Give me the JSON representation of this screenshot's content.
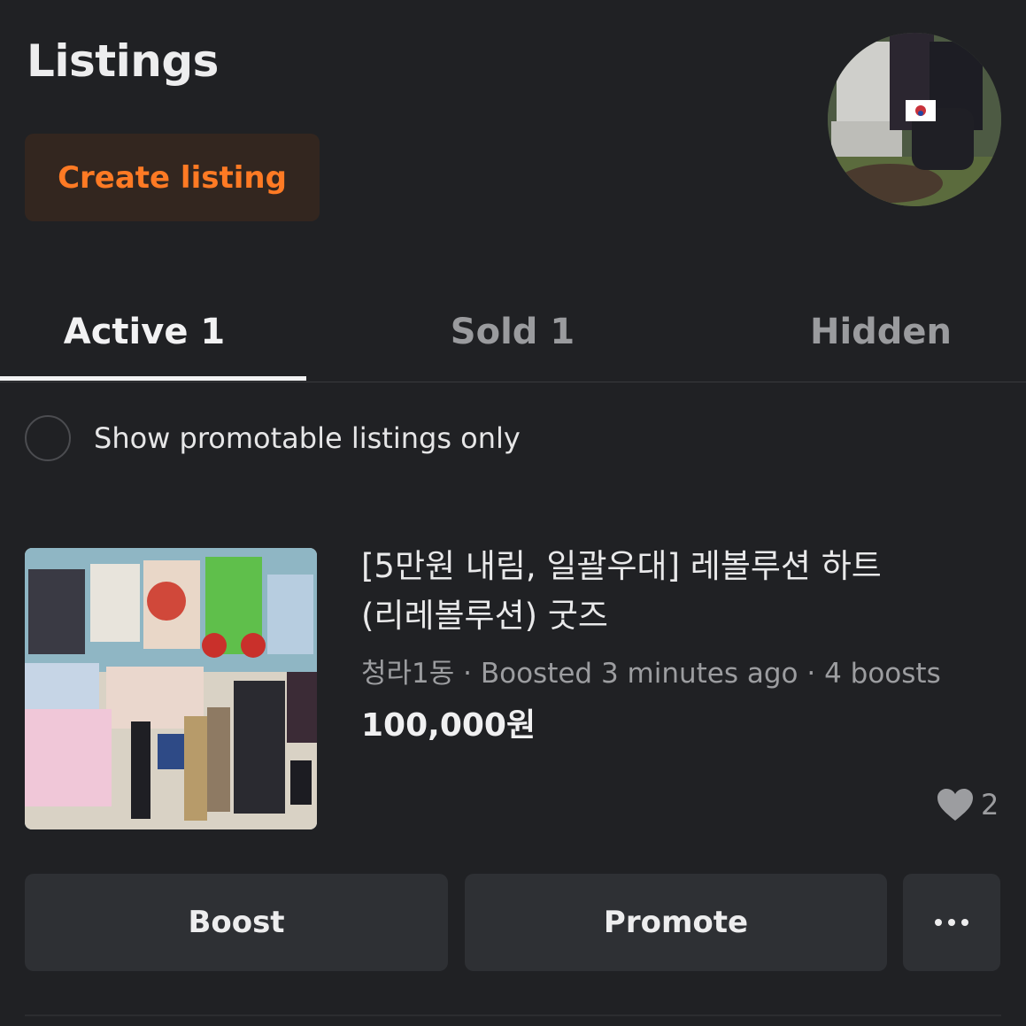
{
  "header": {
    "title": "Listings",
    "create_button_label": "Create listing",
    "avatar_icon": "profile-avatar"
  },
  "tabs": [
    {
      "label": "Active 1",
      "active": true
    },
    {
      "label": "Sold 1",
      "active": false
    },
    {
      "label": "Hidden",
      "active": false
    }
  ],
  "filter": {
    "label": "Show promotable listings only",
    "checked": false
  },
  "listing": {
    "title_line1": "[5만원 내림, 일괄우대] 레볼루션 하트",
    "title_line2": "(리레볼루션) 굿즈",
    "meta": "청라1동 · Boosted 3 minutes ago · 4 boosts",
    "price": "100,000원",
    "likes": "2",
    "like_icon": "heart-icon"
  },
  "actions": {
    "boost_label": "Boost",
    "promote_label": "Promote",
    "more_label": "···",
    "more_icon": "more-options-icon"
  },
  "colors": {
    "background": "#202124",
    "accent_orange": "#ff7a24",
    "button_bg": "#2e3034",
    "create_button_bg": "#33261f"
  }
}
